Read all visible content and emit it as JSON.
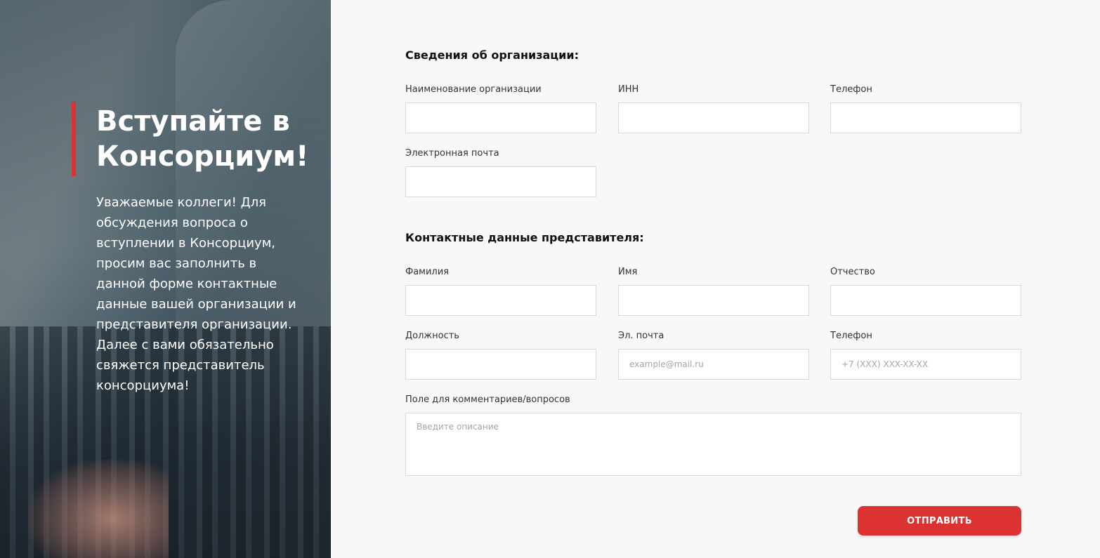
{
  "hero": {
    "title": "Вступайте в Консорциум!",
    "text": "Уважаемые коллеги! Для обсуждения вопроса о вступлении в Консорциум, просим вас заполнить в данной форме контактные данные вашей организации и представителя организации. Далее с вами обязательно свяжется представитель консорциума!"
  },
  "organization": {
    "title": "Сведения об организации:",
    "name_label": "Наименование организации",
    "inn_label": "ИНН",
    "phone_label": "Телефон",
    "email_label": "Электронная почта"
  },
  "representative": {
    "title": "Контактные данные представителя:",
    "lastname_label": "Фамилия",
    "firstname_label": "Имя",
    "patronymic_label": "Отчество",
    "position_label": "Должность",
    "email_label": "Эл. почта",
    "email_placeholder": "example@mail.ru",
    "phone_label": "Телефон",
    "phone_placeholder": "+7 (XXX) XXX-XX-XX",
    "comment_label": "Поле для комментариев/вопросов",
    "comment_placeholder": "Введите описание"
  },
  "submit_label": "ОТПРАВИТЬ",
  "colors": {
    "accent": "#dc3232",
    "background": "#f8f8f8"
  }
}
